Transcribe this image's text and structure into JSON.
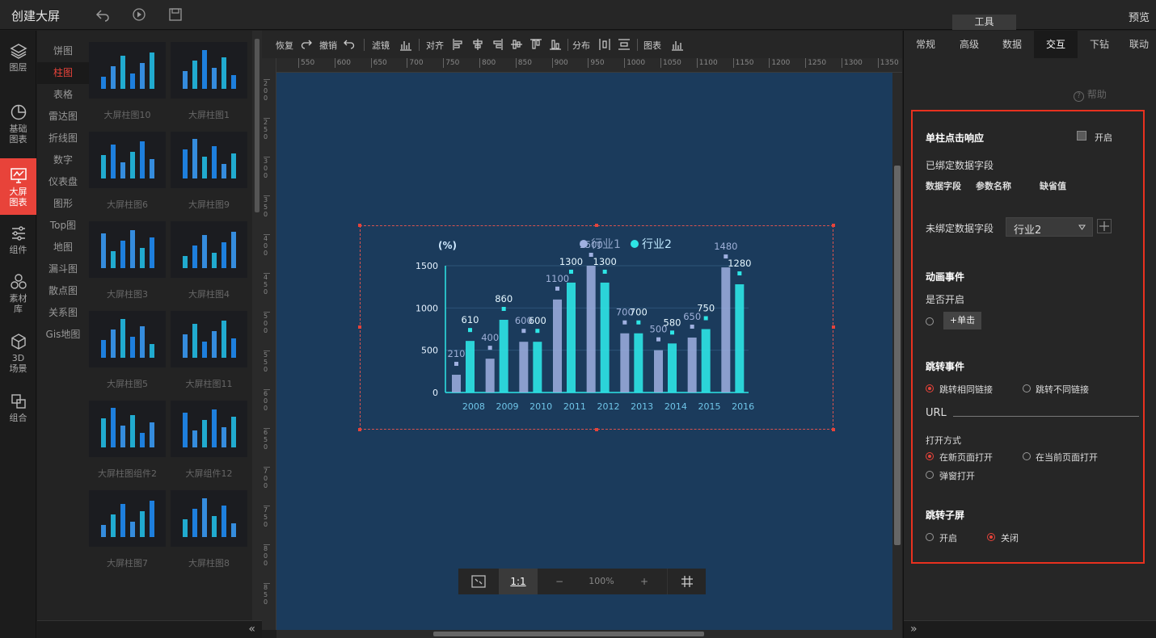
{
  "app": {
    "title": "创建大屏",
    "preview": "预览",
    "tools_tab": "工具"
  },
  "leftnav": [
    {
      "label1": "图层",
      "label2": "",
      "icon": "layers-icon"
    },
    {
      "label1": "基础",
      "label2": "图表",
      "icon": "pie-icon"
    },
    {
      "label1": "大屏",
      "label2": "图表",
      "icon": "screen-chart-icon"
    },
    {
      "label1": "组件",
      "label2": "",
      "icon": "sliders-icon"
    },
    {
      "label1": "素材",
      "label2": "库",
      "icon": "assets-icon"
    },
    {
      "label1": "3D",
      "label2": "场景",
      "icon": "cube-icon"
    },
    {
      "label1": "组合",
      "label2": "",
      "icon": "group-icon"
    }
  ],
  "categories": [
    "饼图",
    "柱图",
    "表格",
    "雷达图",
    "折线图",
    "数字",
    "仪表盘",
    "图形",
    "Top图",
    "地图",
    "漏斗图",
    "散点图",
    "关系图",
    "Gis地图"
  ],
  "thumbnails": [
    "大屏柱图10",
    "大屏柱图1",
    "大屏柱图6",
    "大屏柱图9",
    "大屏柱图3",
    "大屏柱图4",
    "大屏柱图5",
    "大屏柱图11",
    "大屏柱图组件2",
    "大屏组件12",
    "大屏柱图7",
    "大屏柱图8"
  ],
  "toolbar": {
    "restore": "恢复",
    "undo": "撤销",
    "filter": "滤镜",
    "align": "对齐",
    "distribute": "分布",
    "chart": "图表"
  },
  "ruler_h": [
    "550",
    "600",
    "650",
    "700",
    "750",
    "800",
    "850",
    "900",
    "950",
    "1000",
    "1050",
    "1100",
    "1150",
    "1200",
    "1250",
    "1300",
    "1350"
  ],
  "ruler_v": [
    "200",
    "250",
    "300",
    "350",
    "400",
    "450",
    "500",
    "550",
    "600",
    "650",
    "700",
    "750",
    "800",
    "850"
  ],
  "zoom": {
    "ratio": "1:1",
    "minus": "−",
    "value": "100%",
    "plus": "+"
  },
  "right_panel": {
    "tabs": [
      "常规",
      "高级",
      "数据",
      "交互",
      "下钻",
      "联动"
    ],
    "help": "帮助",
    "single_click": "单柱点击响应",
    "single_click_toggle": "开启",
    "bound_fields": "已绑定数据字段",
    "col_field": "数据字段",
    "col_param": "参数名称",
    "col_default": "缺省值",
    "unbound_fields": "未绑定数据字段",
    "unbound_select": "行业2",
    "anim_events": "动画事件",
    "anim_enable": "是否开启",
    "anim_click": "+单击",
    "jump_events": "跳转事件",
    "jump_same": "跳转相同链接",
    "jump_diff": "跳转不同链接",
    "url_label": "URL",
    "open_mode": "打开方式",
    "open_new": "在新页面打开",
    "open_current": "在当前页面打开",
    "open_popup": "弹窗打开",
    "jump_sub": "跳转子屏",
    "sub_on": "开启",
    "sub_off": "关闭"
  },
  "chart_data": {
    "type": "bar",
    "ylabel": "(%)",
    "ylim": [
      0,
      1500
    ],
    "yticks": [
      0,
      500,
      1000,
      1500
    ],
    "categories": [
      "2008",
      "2009",
      "2010",
      "2011",
      "2012",
      "2013",
      "2014",
      "2015",
      "2016"
    ],
    "series": [
      {
        "name": "行业1",
        "values": [
          210,
          400,
          600,
          1100,
          1500,
          700,
          500,
          650,
          1480
        ],
        "color": "#9fb0e0"
      },
      {
        "name": "行业2",
        "values": [
          610,
          860,
          600,
          1300,
          1300,
          700,
          580,
          750,
          1280
        ],
        "color": "#2ee6e6"
      }
    ],
    "legend": "top"
  }
}
